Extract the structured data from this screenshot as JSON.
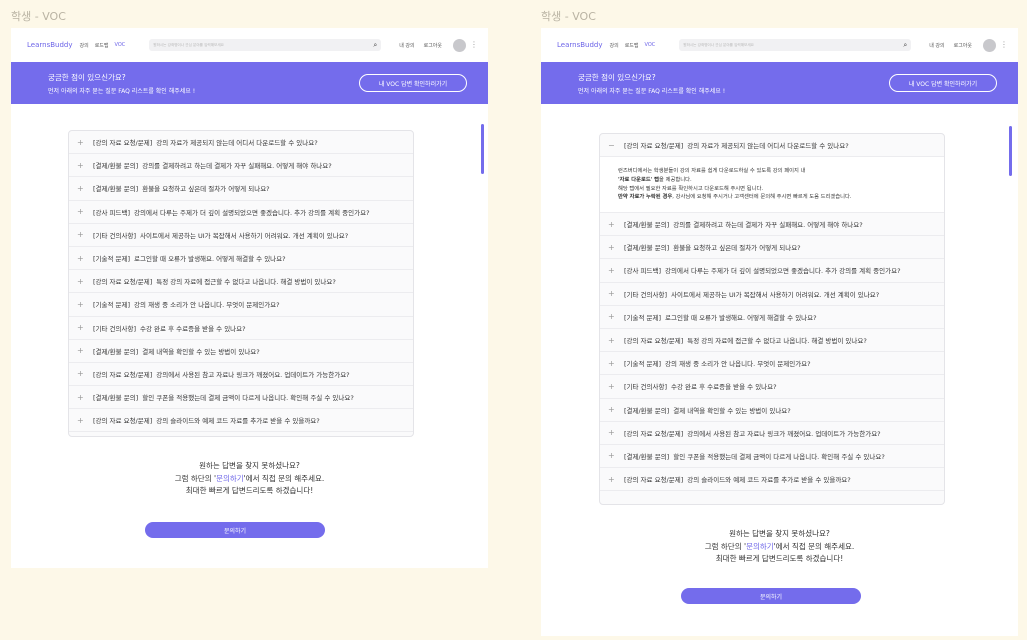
{
  "screens": [
    "학생 - VOC",
    "학생 - VOC"
  ],
  "nav": {
    "logo": "LearnsBuddy",
    "links": [
      "강의",
      "로드맵",
      "VOC"
    ],
    "search_placeholder": "원하시는 강좌명이나 관심 분야를 입력해보세요",
    "right_links": [
      "내 강의",
      "로그아웃"
    ]
  },
  "banner": {
    "line1": "궁금한 점이 있으신가요?",
    "line2": "먼저 아래의 자주 묻는 질문 FAQ 리스트를 확인 해주세요 !",
    "button": "내 VOC 답변 확인하러가기"
  },
  "faqs": [
    {
      "category": "[강의 자료 요청/문제]",
      "question": "강의 자료가 제공되지 않는데 어디서 다운로드할 수 있나요?"
    },
    {
      "category": "[결제/환불 문의]",
      "question": "강의를 결제하려고 하는데 결제가 자꾸 실패해요. 어떻게 해야 하나요?"
    },
    {
      "category": "[결제/환불 문의]",
      "question": "환불을 요청하고 싶은데 절차가 어떻게 되나요?"
    },
    {
      "category": "[강사 피드백]",
      "question": "강의에서 다루는 주제가 더 깊이 설명되었으면 좋겠습니다. 추가 강의를 계획 중인가요?"
    },
    {
      "category": "[기타 건의사항]",
      "question": "사이트에서 제공하는 UI가 복잡해서 사용하기 어려워요. 개선 계획이 있나요?"
    },
    {
      "category": "[기술적 문제]",
      "question": "로그인할 때 오류가 발생해요. 어떻게 해결할 수 있나요?"
    },
    {
      "category": "[강의 자료 요청/문제]",
      "question": "특정 강의 자료에 접근할 수 없다고 나옵니다. 해결 방법이 있나요?"
    },
    {
      "category": "[기술적 문제]",
      "question": "강의 재생 중 소리가 안 나옵니다. 무엇이 문제인가요?"
    },
    {
      "category": "[기타 건의사항]",
      "question": "수강 완료 후 수료증을 받을 수 있나요?"
    },
    {
      "category": "[결제/환불 문의]",
      "question": "결제 내역을 확인할 수 있는 방법이 있나요?"
    },
    {
      "category": "[강의 자료 요청/문제]",
      "question": "강의에서 사용된 참고 자료나 링크가 깨졌어요. 업데이트가 가능한가요?"
    },
    {
      "category": "[결제/환불 문의]",
      "question": "할인 쿠폰을 적용했는데 결제 금액이 다르게 나옵니다. 확인해 주실 수 있나요?"
    },
    {
      "category": "[강의 자료 요청/문제]",
      "question": "강의 슬라이드와 예제 코드 자료를 추가로 받을 수 있을까요?"
    }
  ],
  "answer": {
    "line1": "런즈버디에서는 학생분들이 강의 자료를 쉽게 다운로드하실 수 있도록 강의 페이지 내",
    "line2_bold": "'자료 다운로드' 탭",
    "line2_rest": "을 제공합니다.",
    "line3": "해당 탭에서 필요한 자료를 확인하시고 다운로드해 주시면 됩니다.",
    "line4_bold": "만약 자료가 누락된 경우",
    "line4_rest": ", 강사님에 요청해 주시거나 고객센터에 문의해 주시면 빠르게 도움 드리겠습니다."
  },
  "help": {
    "line1": "원하는 답변을 찾지 못하셨나요?",
    "line2_pre": "그럼 하단의 '",
    "line2_link": "문의하기",
    "line2_post": "'에서 직접 문의 해주세요.",
    "line3": "최대한 빠르게 답변드리도록 하겠습니다!",
    "button": "문의하기"
  },
  "colors": {
    "accent": "#746cec",
    "background": "#fdf8e8"
  }
}
